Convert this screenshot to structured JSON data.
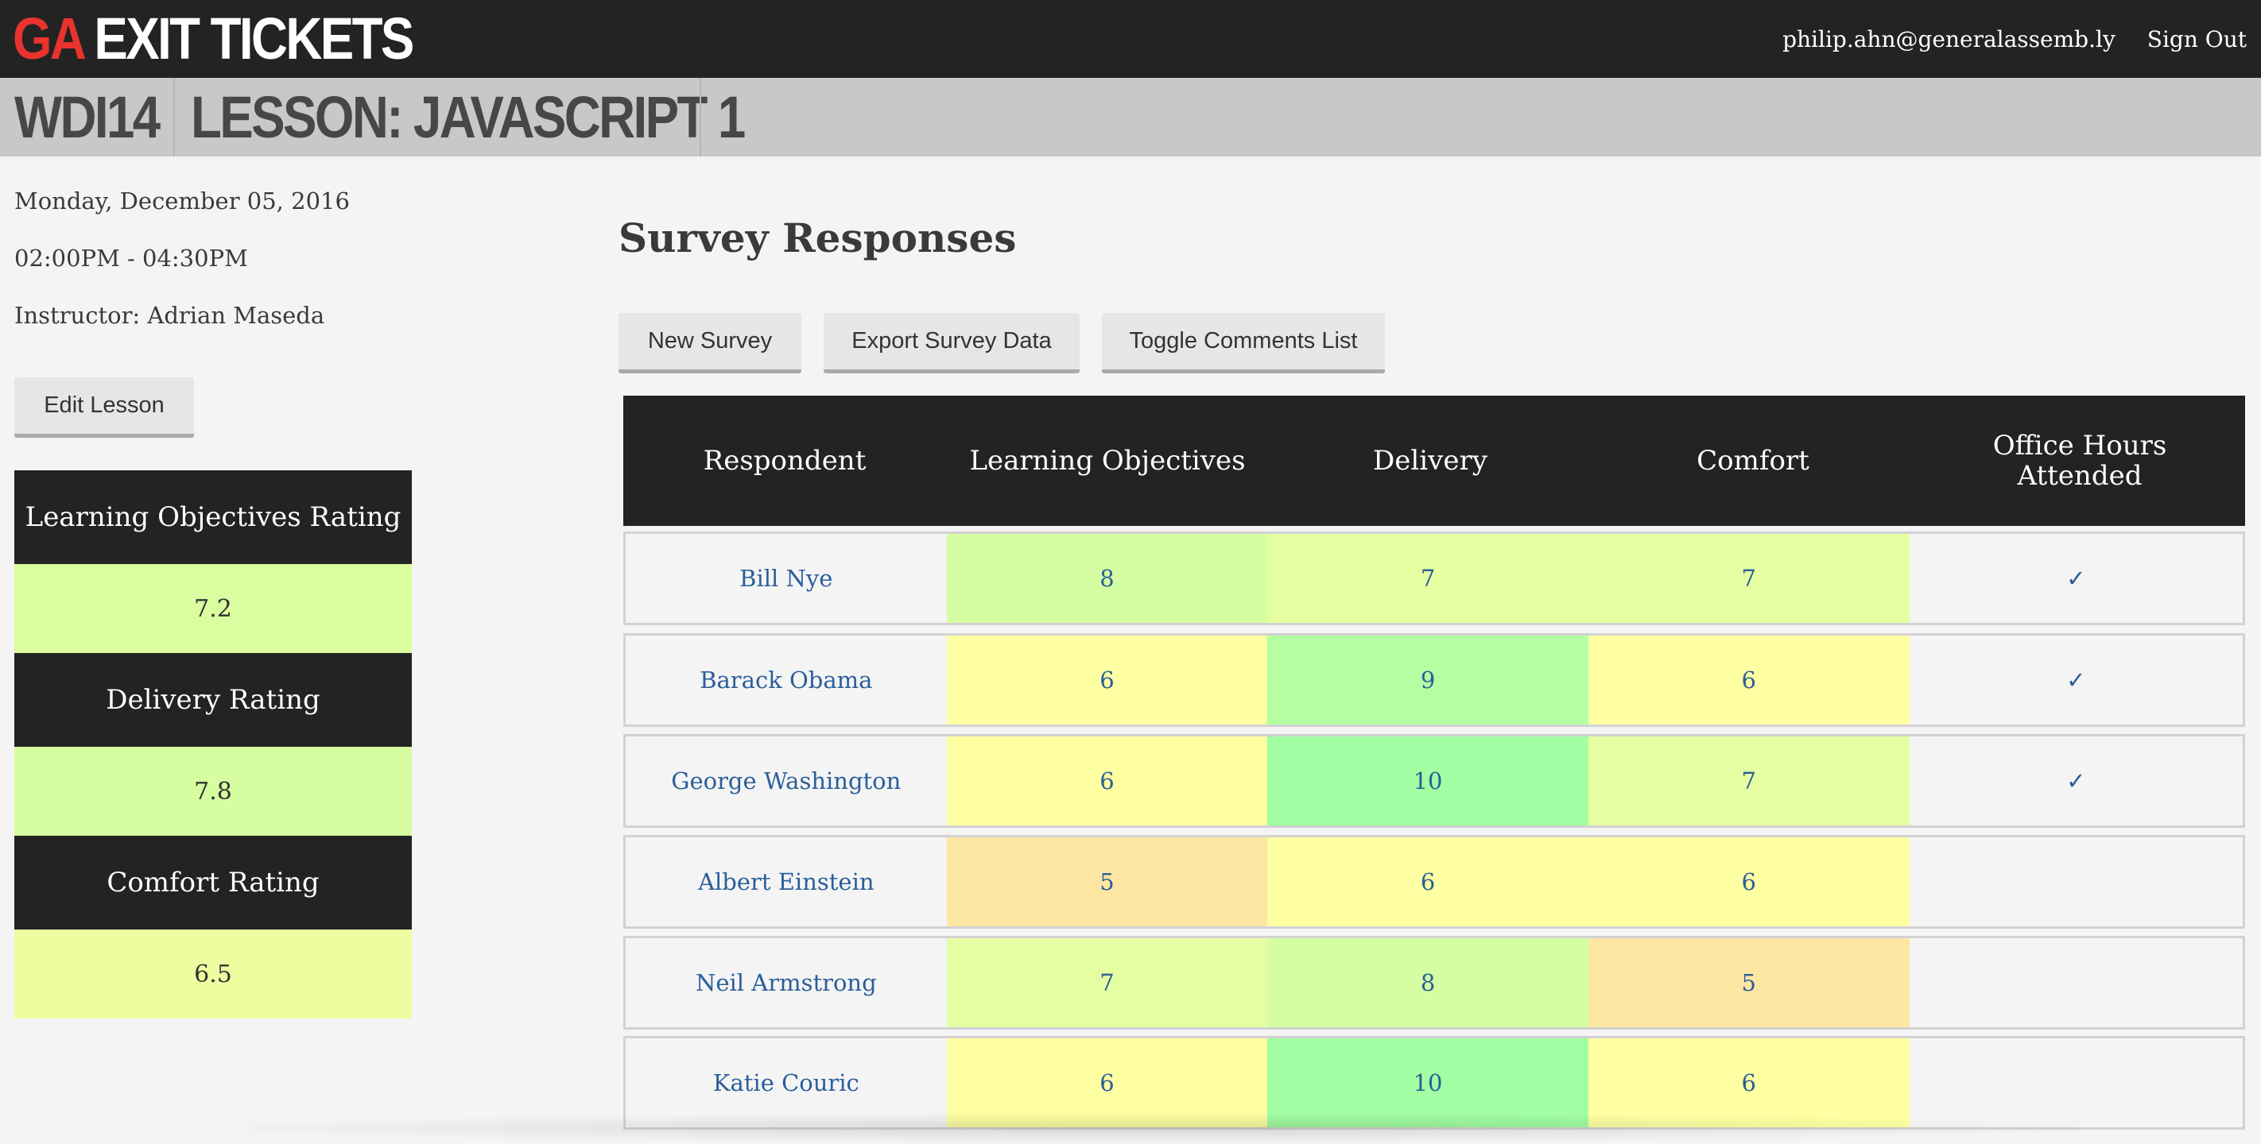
{
  "app": {
    "logo_ga": "GA",
    "logo_title": "EXIT TICKETS",
    "user_email": "philip.ahn@generalassemb.ly",
    "sign_out": "Sign Out"
  },
  "lesson": {
    "cohort": "WDI14",
    "title": "LESSON: JAVASCRIPT 1",
    "date": "Monday, December 05, 2016",
    "time": "02:00PM - 04:30PM",
    "instructor": "Instructor: Adrian Maseda",
    "edit_label": "Edit Lesson"
  },
  "ratings": [
    {
      "label": "Learning Objectives Rating",
      "value": "7.2",
      "color": "#d9fd9f"
    },
    {
      "label": "Delivery Rating",
      "value": "7.8",
      "color": "#d6fd9f"
    },
    {
      "label": "Comfort Rating",
      "value": "6.5",
      "color": "#eefd9f"
    }
  ],
  "survey": {
    "title": "Survey Responses",
    "buttons": {
      "new_survey": "New Survey",
      "export": "Export Survey Data",
      "toggle_comments": "Toggle Comments List"
    },
    "columns": [
      "Respondent",
      "Learning Objectives",
      "Delivery",
      "Comfort",
      "Office Hours Attended"
    ],
    "check_mark": "✓",
    "score_colors": {
      "5": "#fde6a2",
      "6": "#fefea2",
      "7": "#e6fea2",
      "8": "#d5fea2",
      "9": "#b5fea2",
      "10": "#a2fea2"
    },
    "rows": [
      {
        "name": "Bill Nye",
        "objectives": "8",
        "delivery": "7",
        "comfort": "7",
        "office_hours": "✓"
      },
      {
        "name": "Barack Obama",
        "objectives": "6",
        "delivery": "9",
        "comfort": "6",
        "office_hours": "✓"
      },
      {
        "name": "George Washington",
        "objectives": "6",
        "delivery": "10",
        "comfort": "7",
        "office_hours": "✓"
      },
      {
        "name": "Albert Einstein",
        "objectives": "5",
        "delivery": "6",
        "comfort": "6",
        "office_hours": ""
      },
      {
        "name": "Neil Armstrong",
        "objectives": "7",
        "delivery": "8",
        "comfort": "5",
        "office_hours": ""
      },
      {
        "name": "Katie Couric",
        "objectives": "6",
        "delivery": "10",
        "comfort": "6",
        "office_hours": ""
      }
    ]
  }
}
